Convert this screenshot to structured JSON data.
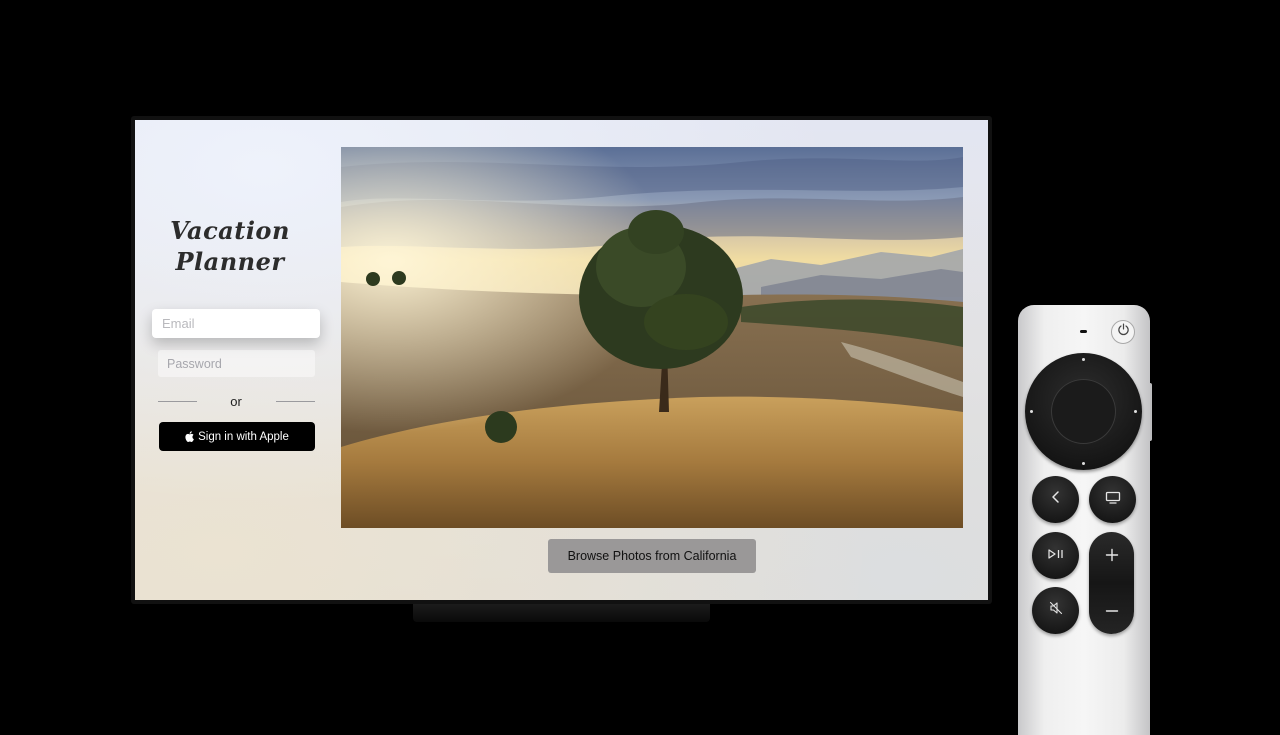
{
  "app": {
    "title_line1": "Vacation",
    "title_line2": "Planner"
  },
  "login": {
    "email_placeholder": "Email",
    "password_placeholder": "Password",
    "divider_text": "or",
    "apple_button_label": "Sign in with Apple",
    "apple_icon": "apple-logo-icon"
  },
  "gallery": {
    "photo_subject": "tree-on-grassy-hill-at-sunset",
    "browse_button_label": "Browse Photos from California"
  },
  "remote": {
    "buttons": [
      "power-icon",
      "back-chevron-icon",
      "tv-icon",
      "play-pause-icon",
      "volume-up-icon",
      "volume-down-icon",
      "mute-icon"
    ]
  },
  "colors": {
    "background": "#000000",
    "apple_button": "#000000",
    "browse_button": "#9a9898",
    "remote_body": "#f2f2f2",
    "remote_buttons": "#1b1b1b"
  }
}
